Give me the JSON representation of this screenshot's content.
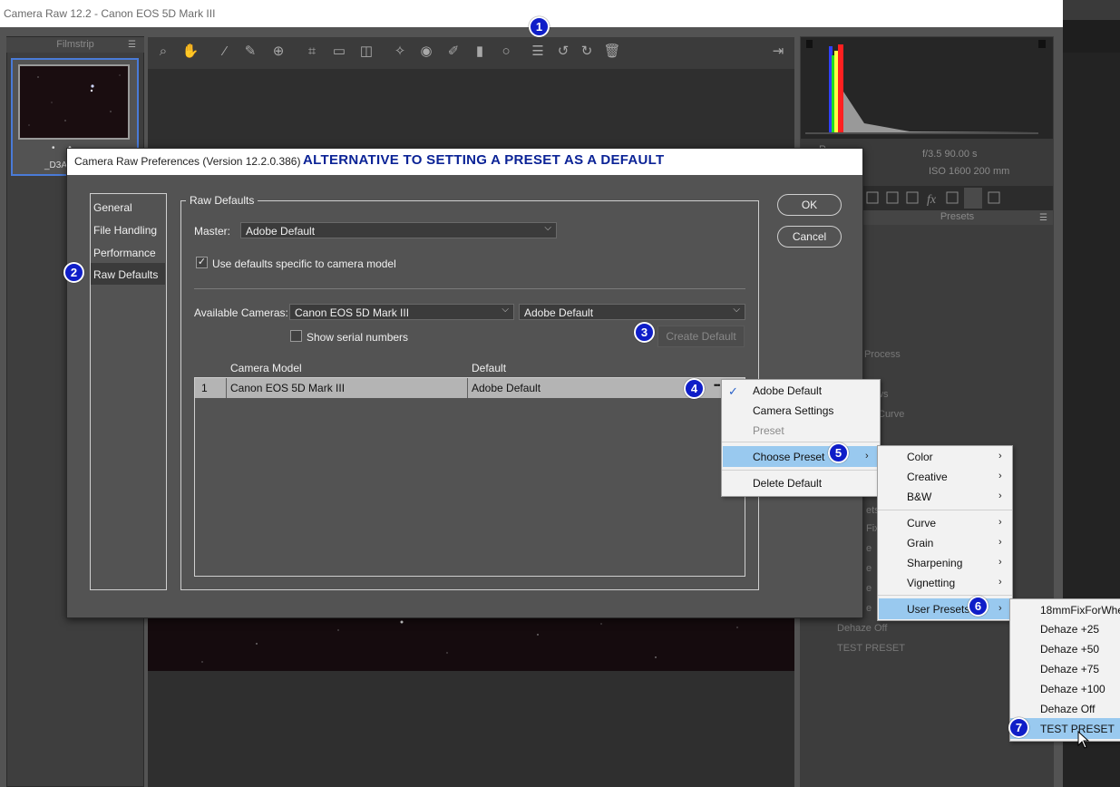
{
  "window": {
    "title": "Camera Raw 12.2  -  Canon EOS 5D Mark III"
  },
  "filmstrip": {
    "header": "Filmstrip",
    "menu_icon": "hamburger-icon",
    "thumbnail_dots": "• •",
    "thumbnail_name": "_D3A"
  },
  "toolbar": {
    "icons": [
      "zoom-icon",
      "hand-icon",
      "white-balance-icon",
      "color-sampler-icon",
      "targeted-adjust-icon",
      "crop-icon",
      "straighten-icon",
      "transform-icon",
      "spot-removal-icon",
      "red-eye-icon",
      "adjustment-brush-icon",
      "graduated-filter-icon",
      "radial-filter-icon",
      "preferences-icon",
      "rotate-left-icon",
      "rotate-right-icon",
      "trash-icon"
    ],
    "exit_icon": "exit-fullscreen-icon"
  },
  "info": {
    "aperture_shutter": "f/3.5   90.00 s",
    "iso_focal": "ISO 1600   200 mm",
    "cut_label": "R"
  },
  "presets_panel": {
    "header": "Presets",
    "bg_items": [
      "Process",
      "ws",
      "Curve",
      "ets",
      "Fix",
      "e",
      "e",
      "e",
      "e"
    ],
    "dehaze_off": "Dehaze Off",
    "test_preset": "TEST PRESET"
  },
  "dialog": {
    "title": "Camera Raw Preferences",
    "version": "(Version 12.2.0.386)",
    "annotation": "ALTERNATIVE TO SETTING A PRESET AS A DEFAULT",
    "nav": [
      "General",
      "File Handling",
      "Performance",
      "Raw Defaults"
    ],
    "selected_nav": "Raw Defaults",
    "group_title": "Raw Defaults",
    "master_label": "Master:",
    "master_value": "Adobe Default",
    "use_defaults_label": "Use defaults specific to camera model",
    "use_defaults_checked": true,
    "available_cameras_label": "Available Cameras:",
    "camera_value": "Canon EOS 5D Mark III",
    "camera_default_value": "Adobe Default",
    "show_serial_label": "Show serial numbers",
    "show_serial_checked": false,
    "create_default": "Create Default",
    "ok": "OK",
    "cancel": "Cancel",
    "table": {
      "headers": [
        "Camera Model",
        "Default"
      ],
      "rows": [
        {
          "index": "1",
          "model": "Canon EOS 5D Mark III",
          "default": "Adobe Default",
          "more": "•••"
        }
      ]
    }
  },
  "context_menu": {
    "items": [
      {
        "label": "Adobe Default",
        "checked": true
      },
      {
        "label": "Camera Settings"
      },
      {
        "label": "Preset",
        "disabled": true
      },
      {
        "label": "Choose Preset",
        "highlighted": true
      },
      {
        "label": "Delete Default"
      }
    ]
  },
  "preset_menu": {
    "items": [
      "Color",
      "Creative",
      "B&W",
      "Curve",
      "Grain",
      "Sharpening",
      "Vignetting",
      "User Presets"
    ],
    "highlighted": "User Presets"
  },
  "user_presets_menu": {
    "items": [
      "18mmFixForWhe",
      "Dehaze +25",
      "Dehaze +50",
      "Dehaze +75",
      "Dehaze +100",
      "Dehaze Off",
      "TEST PRESET"
    ],
    "highlighted": "TEST PRESET"
  },
  "badges": [
    "1",
    "2",
    "3",
    "4",
    "5",
    "6",
    "7"
  ],
  "colors": {
    "badge": "#0f1ec8",
    "annotation": "#0b2396",
    "menu_highlight": "#99c9ef",
    "thumb_border": "#4a7bd8"
  }
}
